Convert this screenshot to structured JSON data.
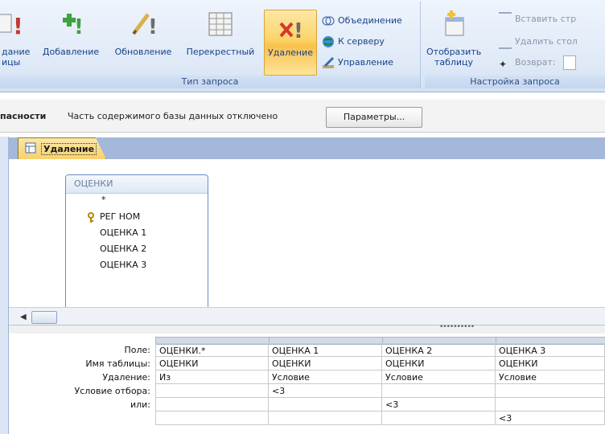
{
  "ribbon": {
    "group_query_type_label": "Тип запроса",
    "group_query_setup_label": "Настройка запроса",
    "buttons": {
      "make_table_line1": "дание",
      "make_table_line2": "ицы",
      "append": "Добавление",
      "update": "Обновление",
      "crosstab": "Перекрестный",
      "delete": "Удаление",
      "union": "Объединение",
      "pass_through": "К серверу",
      "data_definition": "Управление",
      "show_table_line1": "Отобразить",
      "show_table_line2": "таблицу",
      "insert_rows": "Вставить стр",
      "delete_rows": "Удалить стол",
      "return": "Возврат:"
    }
  },
  "message_bar": {
    "title": "пасности",
    "text": "Часть содержимого базы данных отключено",
    "options_button": "Параметры..."
  },
  "document_tab": {
    "label": "Удаление"
  },
  "table_box": {
    "title": "ОЦЕНКИ",
    "fields": [
      "*",
      "РЕГ НОМ",
      "ОЦЕНКА 1",
      "ОЦЕНКА 2",
      "ОЦЕНКА 3"
    ]
  },
  "grid": {
    "row_labels": [
      "Поле:",
      "Имя таблицы:",
      "Удаление:",
      "Условие отбора:",
      "или:"
    ],
    "columns": [
      {
        "field": "ОЦЕНКИ.*",
        "table": "ОЦЕНКИ",
        "delete": "Из",
        "criteria": "",
        "or": "",
        "extra": ""
      },
      {
        "field": "ОЦЕНКА 1",
        "table": "ОЦЕНКИ",
        "delete": "Условие",
        "criteria": "<3",
        "or": "",
        "extra": ""
      },
      {
        "field": "ОЦЕНКА 2",
        "table": "ОЦЕНКИ",
        "delete": "Условие",
        "criteria": "",
        "or": "<3",
        "extra": ""
      },
      {
        "field": "ОЦЕНКА 3",
        "table": "ОЦЕНКИ",
        "delete": "Условие",
        "criteria": "",
        "or": "",
        "extra": "<3"
      }
    ]
  },
  "colors": {
    "active_button": "#f9c14b",
    "ribbon_text": "#15428b",
    "tab_strip": "#a4b8da"
  }
}
